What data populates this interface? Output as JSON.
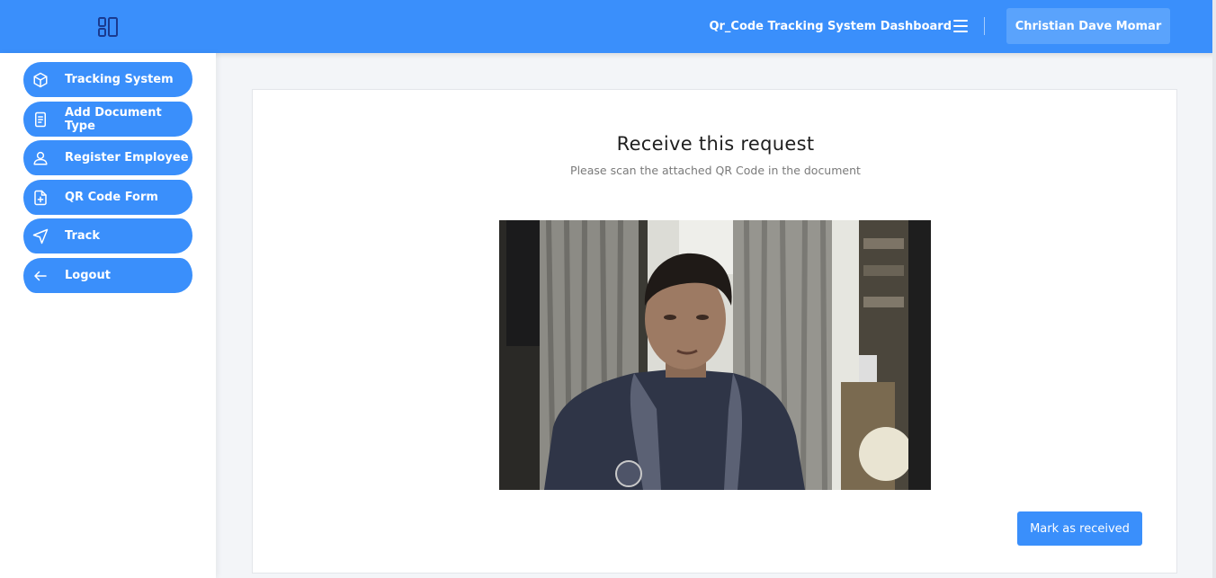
{
  "header": {
    "title": "Qr_Code Tracking System Dashboard",
    "user_name": "Christian Dave Momar",
    "brand_icon": "layout-icon",
    "menu_icon": "hamburger-icon"
  },
  "sidebar": {
    "items": [
      {
        "label": "Tracking System",
        "icon": "cube-icon"
      },
      {
        "label": "Add Document Type",
        "icon": "document-icon"
      },
      {
        "label": "Register Employee",
        "icon": "user-icon"
      },
      {
        "label": "QR Code Form",
        "icon": "file-plus-icon"
      },
      {
        "label": "Track",
        "icon": "navigation-icon"
      },
      {
        "label": "Logout",
        "icon": "arrow-left-icon"
      }
    ]
  },
  "main": {
    "title": "Receive this request",
    "subtitle": "Please scan the attached QR Code in the document",
    "camera_feed": "webcam-video-feed",
    "mark_button_label": "Mark as received"
  },
  "colors": {
    "primary": "#3a8ffb",
    "user_button": "#5aa3fc",
    "background": "#f3f5f8"
  }
}
